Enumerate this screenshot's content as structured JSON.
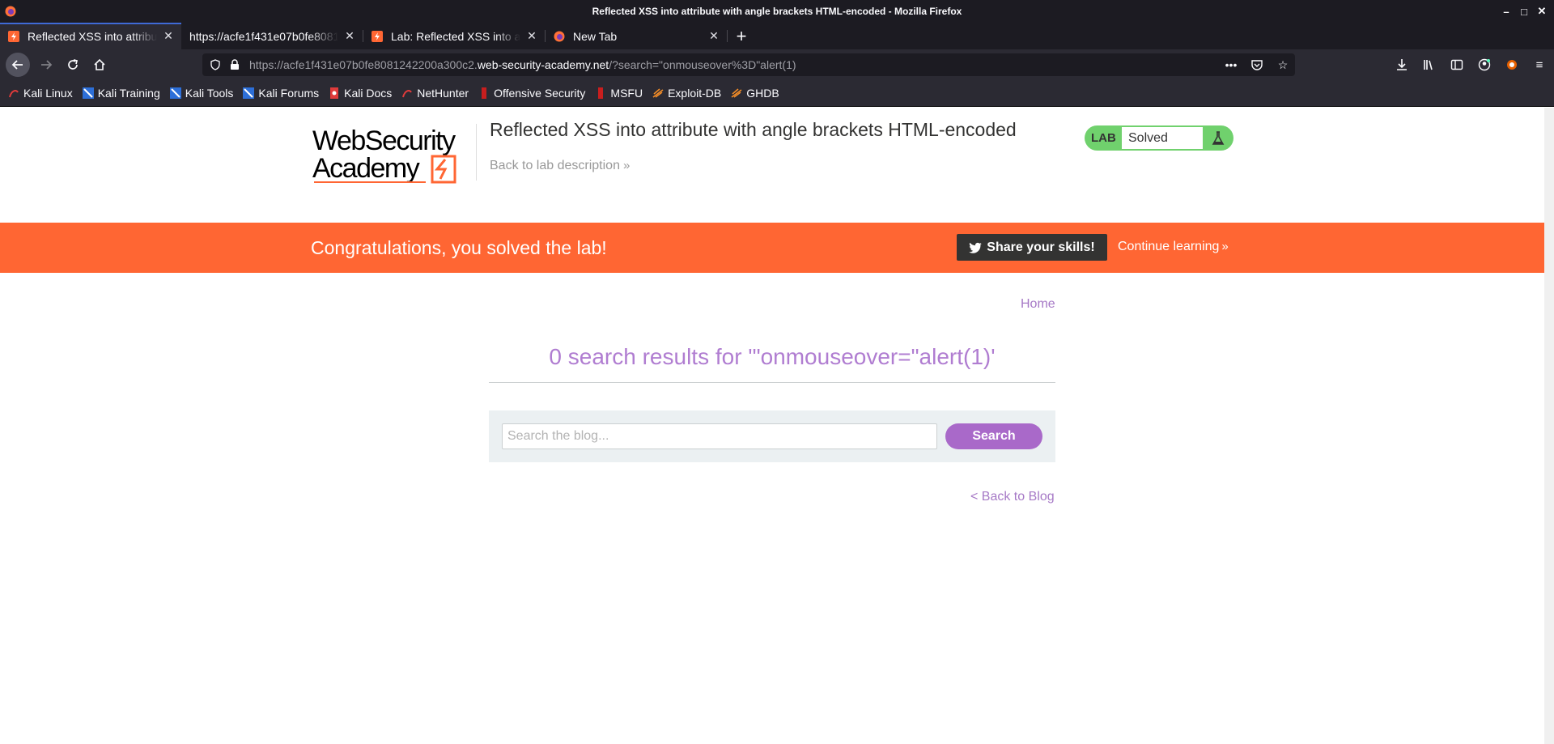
{
  "window": {
    "title": "Reflected XSS into attribute with angle brackets HTML-encoded - Mozilla Firefox"
  },
  "tabs": [
    {
      "title": "Reflected XSS into attribute with angle brackets HTML-encoded",
      "active": true,
      "icon": "portswigger-icon"
    },
    {
      "title": "https://acfe1f431e07b0fe8081242200a300c2.web-security-academy.net",
      "active": false,
      "icon": "none"
    },
    {
      "title": "Lab: Reflected XSS into attribute with angle brackets HTML-encoded",
      "active": false,
      "icon": "portswigger-icon"
    },
    {
      "title": "New Tab",
      "active": false,
      "icon": "firefox-icon"
    }
  ],
  "url": {
    "prefix": "https://acfe1f431e07b0fe8081242200a300c2.",
    "domain": "web-security-academy.net",
    "path": "/?search=\"onmouseover%3D\"alert(1)"
  },
  "bookmarks": [
    {
      "label": "Kali Linux",
      "icon": "kali-icon"
    },
    {
      "label": "Kali Training",
      "icon": "kali-training-icon"
    },
    {
      "label": "Kali Tools",
      "icon": "kali-tools-icon"
    },
    {
      "label": "Kali Forums",
      "icon": "kali-forums-icon"
    },
    {
      "label": "Kali Docs",
      "icon": "kali-docs-icon"
    },
    {
      "label": "NetHunter",
      "icon": "nethunter-icon"
    },
    {
      "label": "Offensive Security",
      "icon": "offsec-icon"
    },
    {
      "label": "MSFU",
      "icon": "msfu-icon"
    },
    {
      "label": "Exploit-DB",
      "icon": "exploitdb-icon"
    },
    {
      "label": "GHDB",
      "icon": "ghdb-icon"
    }
  ],
  "lab": {
    "logo_line1": "WebSecurity",
    "logo_line2": "Academy",
    "title": "Reflected XSS into attribute with angle brackets HTML-encoded",
    "back_link": "Back to lab description",
    "status_tag": "LAB",
    "status_value": "Solved"
  },
  "banner": {
    "message": "Congratulations, you solved the lab!",
    "share_label": "Share your skills!",
    "continue_label": "Continue learning"
  },
  "content": {
    "home_link": "Home",
    "results_title": "0 search results for '\"onmouseover=\"alert(1)'",
    "search_placeholder": "Search the blog...",
    "search_button": "Search",
    "back_link": "< Back to Blog"
  },
  "colors": {
    "accent_orange": "#ff6633",
    "accent_purple": "#a969c9",
    "lab_green": "#70d16d"
  }
}
